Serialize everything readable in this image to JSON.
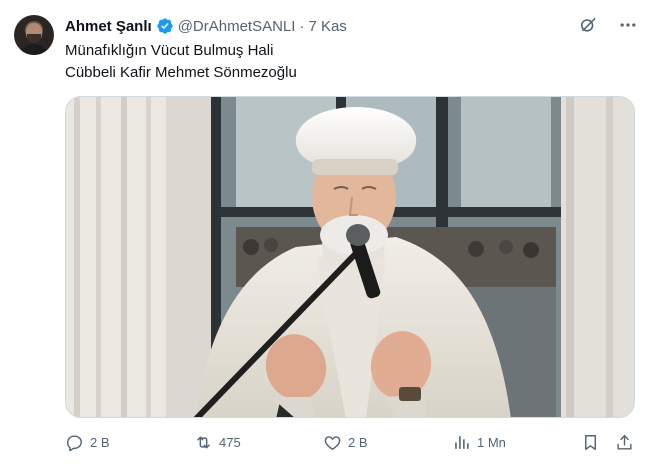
{
  "author": {
    "name": "Ahmet Şanlı",
    "handle": "@DrAhmetSANLI",
    "separator": "·",
    "date": "7 Kas",
    "verified": true,
    "avatar_icon": "user-avatar"
  },
  "tweet": {
    "lines": [
      "Münafıklığın Vücut Bulmuş Hali",
      "Cübbeli Kafir Mehmet Sönmezoğlu"
    ]
  },
  "media": {
    "kind": "photo",
    "subject": "man-in-white-turban-praying-at-microphone"
  },
  "top_icons": [
    "grok-icon",
    "more-icon"
  ],
  "actions": {
    "reply": {
      "icon": "reply-icon",
      "count": "2 B"
    },
    "repost": {
      "icon": "repost-icon",
      "count": "475"
    },
    "like": {
      "icon": "like-icon",
      "count": "2 B"
    },
    "views": {
      "icon": "views-icon",
      "count": "1 Mn"
    },
    "bookmark": {
      "icon": "bookmark-icon"
    },
    "share": {
      "icon": "share-icon"
    }
  },
  "colors": {
    "text": "#0f1419",
    "muted": "#536471",
    "verified": "#1d9bf0",
    "border": "#cfd9de"
  }
}
